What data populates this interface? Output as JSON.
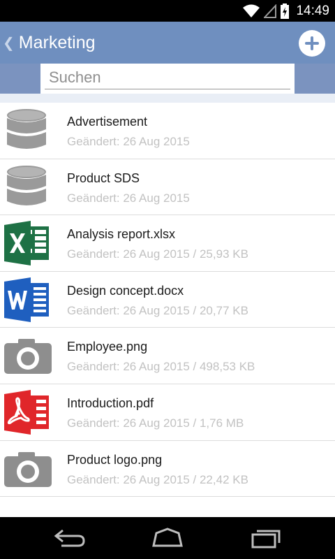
{
  "status_bar": {
    "time": "14:49",
    "icons": [
      "wifi-icon",
      "signal-icon",
      "battery-charging-icon"
    ]
  },
  "action_bar": {
    "title": "Marketing",
    "back_icon": "chevron-left-icon",
    "add_icon": "plus-circle-icon",
    "color": "#6f8fbf"
  },
  "search": {
    "placeholder": "Suchen",
    "value": ""
  },
  "files": [
    {
      "name": "Advertisement",
      "meta": "Geändert: 26 Aug 2015",
      "icon": "database-icon"
    },
    {
      "name": "Product SDS",
      "meta": "Geändert: 26 Aug 2015",
      "icon": "database-icon"
    },
    {
      "name": "Analysis report.xlsx",
      "meta": "Geändert: 26 Aug 2015 / 25,93 KB",
      "icon": "excel-icon"
    },
    {
      "name": "Design concept.docx",
      "meta": "Geändert: 26 Aug 2015 / 20,77 KB",
      "icon": "word-icon"
    },
    {
      "name": "Employee.png",
      "meta": "Geändert: 26 Aug 2015 / 498,53 KB",
      "icon": "camera-icon"
    },
    {
      "name": "Introduction.pdf",
      "meta": "Geändert: 26 Aug 2015 / 1,76 MB",
      "icon": "pdf-icon"
    },
    {
      "name": "Product logo.png",
      "meta": "Geändert: 26 Aug 2015 / 22,42 KB",
      "icon": "camera-icon"
    }
  ],
  "nav_bar": {
    "buttons": [
      "back-icon",
      "home-icon",
      "recents-icon"
    ]
  },
  "colors": {
    "excel": "#1e7145",
    "word": "#1f5fbf",
    "pdf": "#e0262a",
    "gray_icon": "#8e8e8e"
  }
}
